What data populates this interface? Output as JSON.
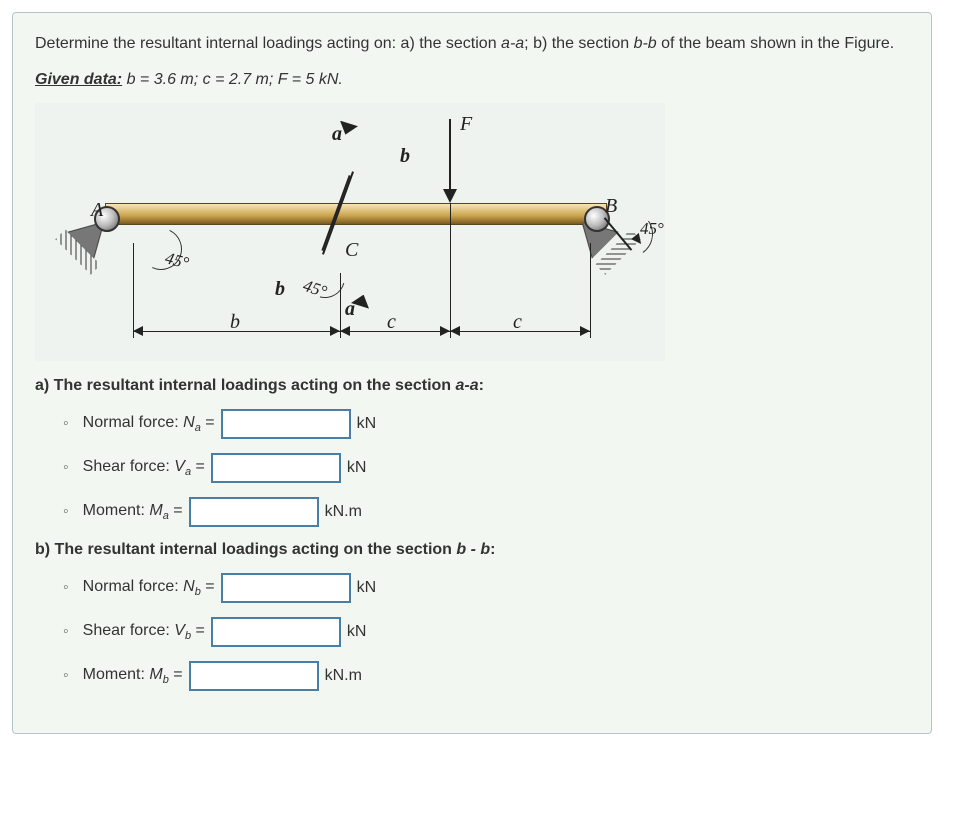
{
  "prompt": {
    "p1a": "Determine the resultant internal loadings acting on: a) the section ",
    "sec_aa": "a-a",
    "p1b": "; b)  the section ",
    "sec_bb": "b-b",
    "p1c": " of the beam shown in the Figure."
  },
  "given": {
    "label": "Given data:",
    "text": " b = 3.6 m;  c = 2.7 m;  F = 5 kN."
  },
  "figure": {
    "A": "A",
    "B": "B",
    "C": "C",
    "F": "F",
    "a": "a",
    "b_sec": "b",
    "b_dim": "b",
    "c_dim": "c",
    "ang45": "45°",
    "ang45b": "45°",
    "ang45r": "45°"
  },
  "partA": {
    "heading_a": "a) The resultant internal loadings acting on the section ",
    "heading_sec": "a-a",
    "heading_b": ":",
    "normal_label_a": "Normal force: ",
    "N": "N",
    "sub_a": "a",
    "eq": " = ",
    "unit_kN": "kN",
    "shear_label_a": "Shear force: ",
    "V": "V",
    "moment_label_a": "Moment: ",
    "M": "M",
    "unit_kNm": "kN.m"
  },
  "partB": {
    "heading_a": "b) The resultant internal loadings acting on the section ",
    "heading_sec": "b - b",
    "heading_b": ":",
    "sub_b": "b"
  }
}
